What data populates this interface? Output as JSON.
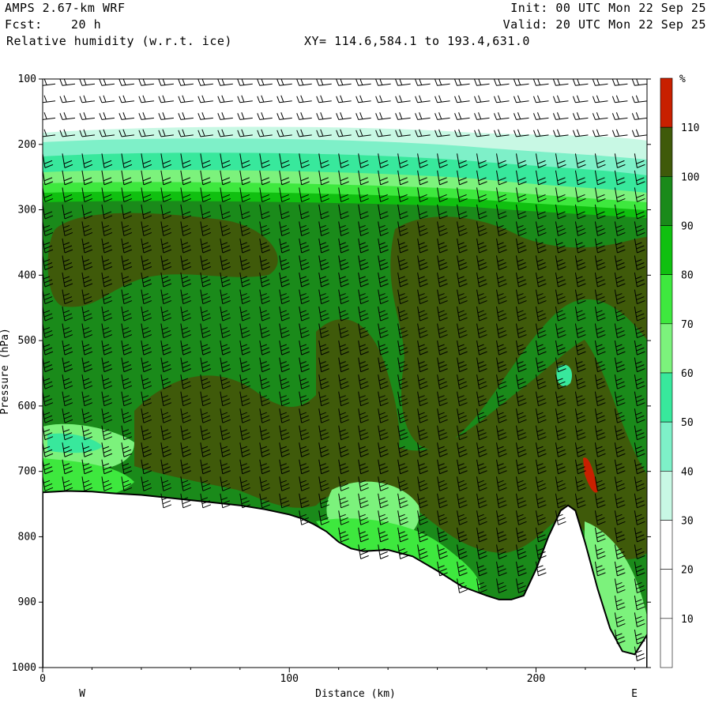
{
  "header": {
    "model": "AMPS 2.67-km WRF",
    "fcst_label": "Fcst:",
    "fcst_value": "20 h",
    "field": "Relative humidity (w.r.t. ice)",
    "xy": "XY= 114.6,584.1 to 193.4,631.0",
    "init": "Init: 00 UTC Mon 22 Sep 25",
    "valid": "Valid: 20 UTC Mon 22 Sep 25"
  },
  "chart_data": {
    "type": "heatmap",
    "title": "Relative humidity (w.r.t. ice)",
    "xlabel": "Distance (km)",
    "ylabel": "Pressure (hPa)",
    "x_range": [
      0,
      245
    ],
    "y_range": [
      1000,
      100
    ],
    "y_scale": "linear, inverted",
    "x_ticks": [
      0,
      100,
      200
    ],
    "y_ticks": [
      100,
      200,
      300,
      400,
      500,
      600,
      700,
      800,
      900,
      1000
    ],
    "x_end_labels": {
      "left": "W",
      "right": "E"
    },
    "colorbar": {
      "unit": "%",
      "levels": [
        10,
        20,
        30,
        40,
        50,
        60,
        70,
        80,
        90,
        100,
        110
      ],
      "colors": [
        "#ffffff",
        "#ffffff",
        "#ffffff",
        "#c8f8e4",
        "#7ef0c8",
        "#38e89c",
        "#7cf27c",
        "#3ee83e",
        "#10c010",
        "#1a8a1a",
        "#3f5a0a",
        "#c82000"
      ]
    },
    "terrain_profile": {
      "x": [
        0,
        10,
        20,
        30,
        40,
        50,
        60,
        70,
        80,
        90,
        100,
        105,
        110,
        115,
        120,
        125,
        130,
        140,
        150,
        160,
        170,
        180,
        185,
        190,
        195,
        200,
        205,
        210,
        213,
        216,
        220,
        225,
        230,
        235,
        240,
        245
      ],
      "pressure": [
        732,
        730,
        731,
        734,
        736,
        740,
        744,
        748,
        752,
        758,
        766,
        772,
        781,
        792,
        808,
        818,
        822,
        820,
        830,
        852,
        876,
        890,
        896,
        896,
        890,
        850,
        800,
        760,
        752,
        760,
        810,
        880,
        940,
        975,
        980,
        950
      ]
    },
    "wind_barbs": "Wind barbs (knots) overplotted on the cross-section grid"
  }
}
